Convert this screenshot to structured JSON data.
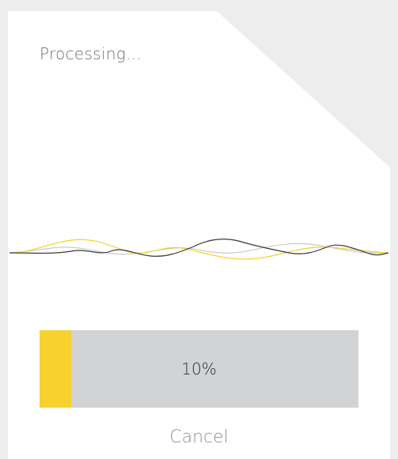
{
  "dialog": {
    "title": "Processing...",
    "progress": {
      "value_percent": 10,
      "label": "10%"
    },
    "cancel_label": "Cancel"
  },
  "colors": {
    "background": "#ededed",
    "panel": "#ffffff",
    "accent": "#f7d12e",
    "track": "#d1d3d5",
    "wave_dark": "#3a3a3a",
    "wave_light": "#c4c4c4"
  }
}
